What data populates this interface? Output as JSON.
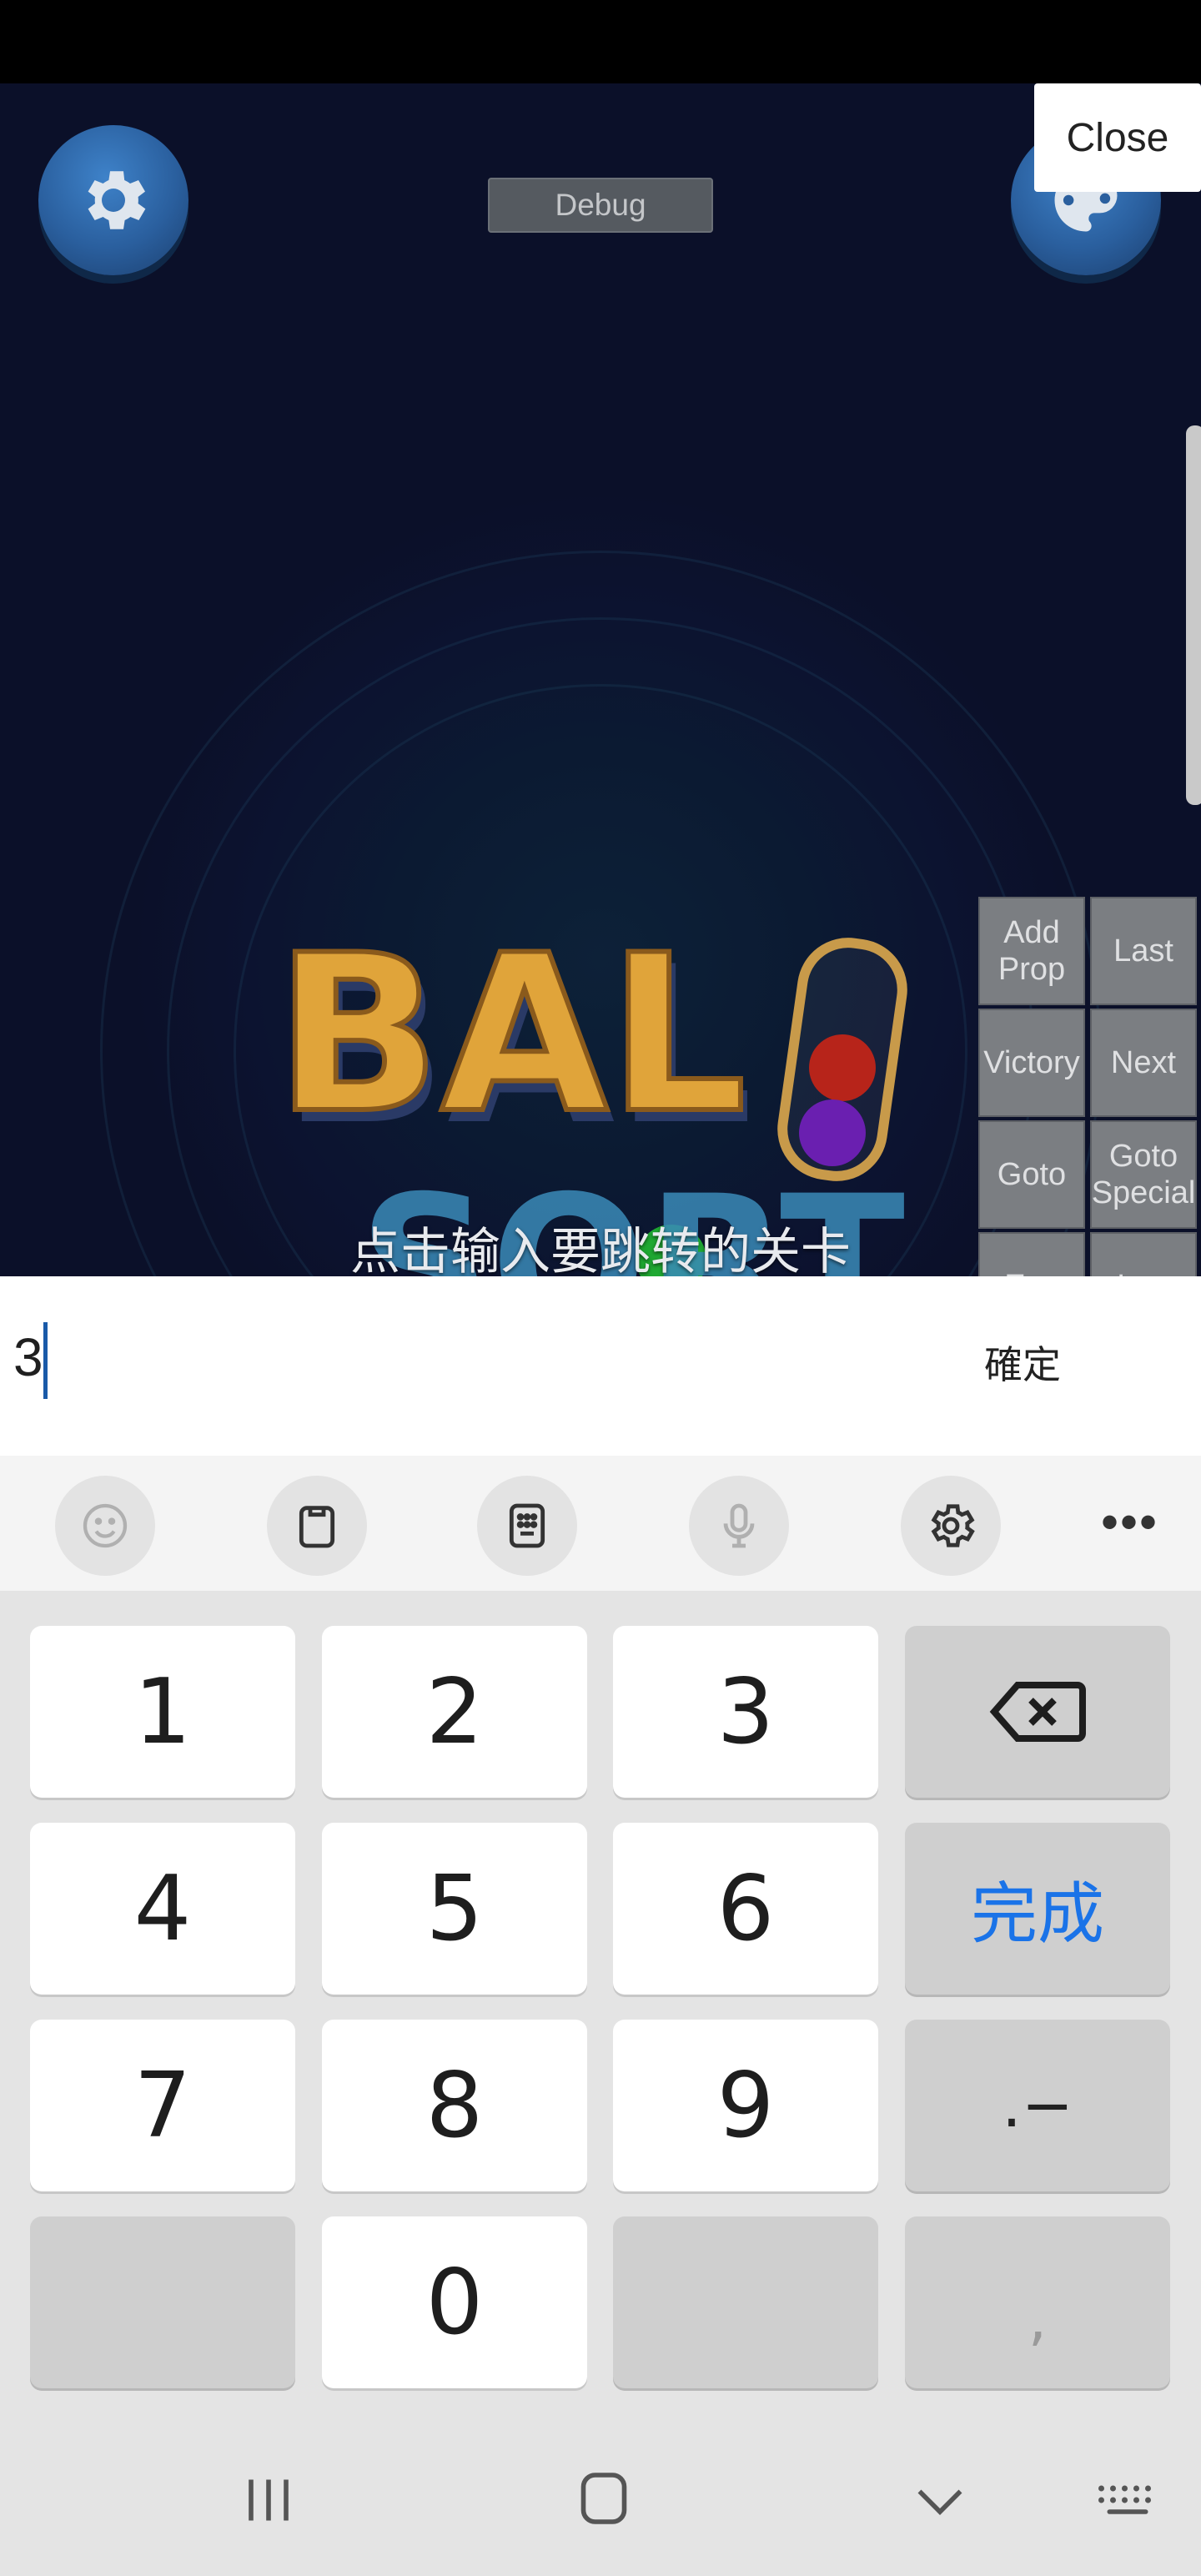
{
  "game": {
    "debug_label": "Debug",
    "close_label": "Close",
    "hint": "点击输入要跳转的关卡",
    "logo_word1": "BAL",
    "logo_word2": "SORT",
    "debug_buttons": [
      "Add\nProp",
      "Last",
      "Victory",
      "Next",
      "Goto",
      "Goto\nSpecial",
      "Exp",
      "Log"
    ]
  },
  "input": {
    "value": "3",
    "confirm_label": "確定"
  },
  "keyboard": {
    "toolbar": [
      "emoji-icon",
      "clipboard-icon",
      "keypad-icon",
      "mic-icon",
      "settings-icon",
      "more-icon"
    ],
    "keys": {
      "k1": "1",
      "k2": "2",
      "k3": "3",
      "k4": "4",
      "k5": "5",
      "k6": "6",
      "k7": "7",
      "k8": "8",
      "k9": "9",
      "k0": "0",
      "done": "完成",
      "punct": ".−",
      "comma": ","
    }
  },
  "navbar": [
    "recent-apps-icon",
    "home-icon",
    "back-icon",
    "keyboard-switch-icon"
  ],
  "colors": {
    "accent": "#1a73e8",
    "game_bg": "#0b1029",
    "button_blue": "#2a5f9e",
    "logo_gold": "#e0a43a"
  }
}
